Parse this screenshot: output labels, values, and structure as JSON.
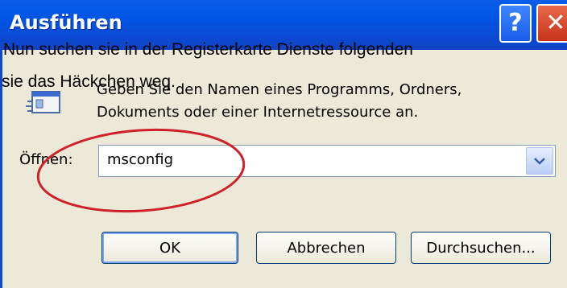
{
  "dialog": {
    "title": "Ausführen",
    "help_label": "?",
    "close_label": "✕",
    "description": "Geben Sie den Namen eines Programms, Ordners, Dokuments oder einer Internetressource an.",
    "open_label": "Öffnen:",
    "open_value": "msconfig",
    "buttons": {
      "ok": "OK",
      "cancel": "Abbrechen",
      "browse": "Durchsuchen..."
    }
  },
  "overlay": {
    "line1": "Nun suchen sie in der Registerkarte Dienste folgenden",
    "line2": "sie das Häckchen weg."
  },
  "icons": {
    "help": "help-icon",
    "close": "close-icon",
    "program": "program-icon",
    "dropdown": "chevron-down-icon"
  },
  "colors": {
    "titlebar": "#0055e6",
    "dialog_bg": "#ece9d8",
    "highlight_circle": "#d0202a"
  }
}
